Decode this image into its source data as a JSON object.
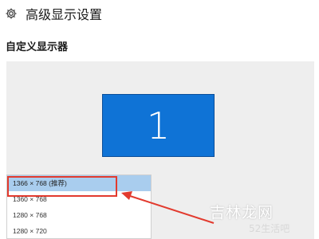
{
  "header": {
    "icon": "gear-icon",
    "title": "高级显示设置"
  },
  "section": {
    "label": "自定义显示器"
  },
  "display": {
    "monitor_number": "1",
    "monitor_color": "#0f73d6"
  },
  "resolution_dropdown": {
    "options": [
      {
        "label": "1366 × 768 (推荐)",
        "selected": true
      },
      {
        "label": "1360 × 768",
        "selected": false
      },
      {
        "label": "1280 × 768",
        "selected": false
      },
      {
        "label": "1280 × 720",
        "selected": false
      }
    ]
  },
  "annotation": {
    "highlight_color": "#e23a2e"
  },
  "watermark": {
    "main": "吉林龙网",
    "sub": "52生活吧"
  }
}
